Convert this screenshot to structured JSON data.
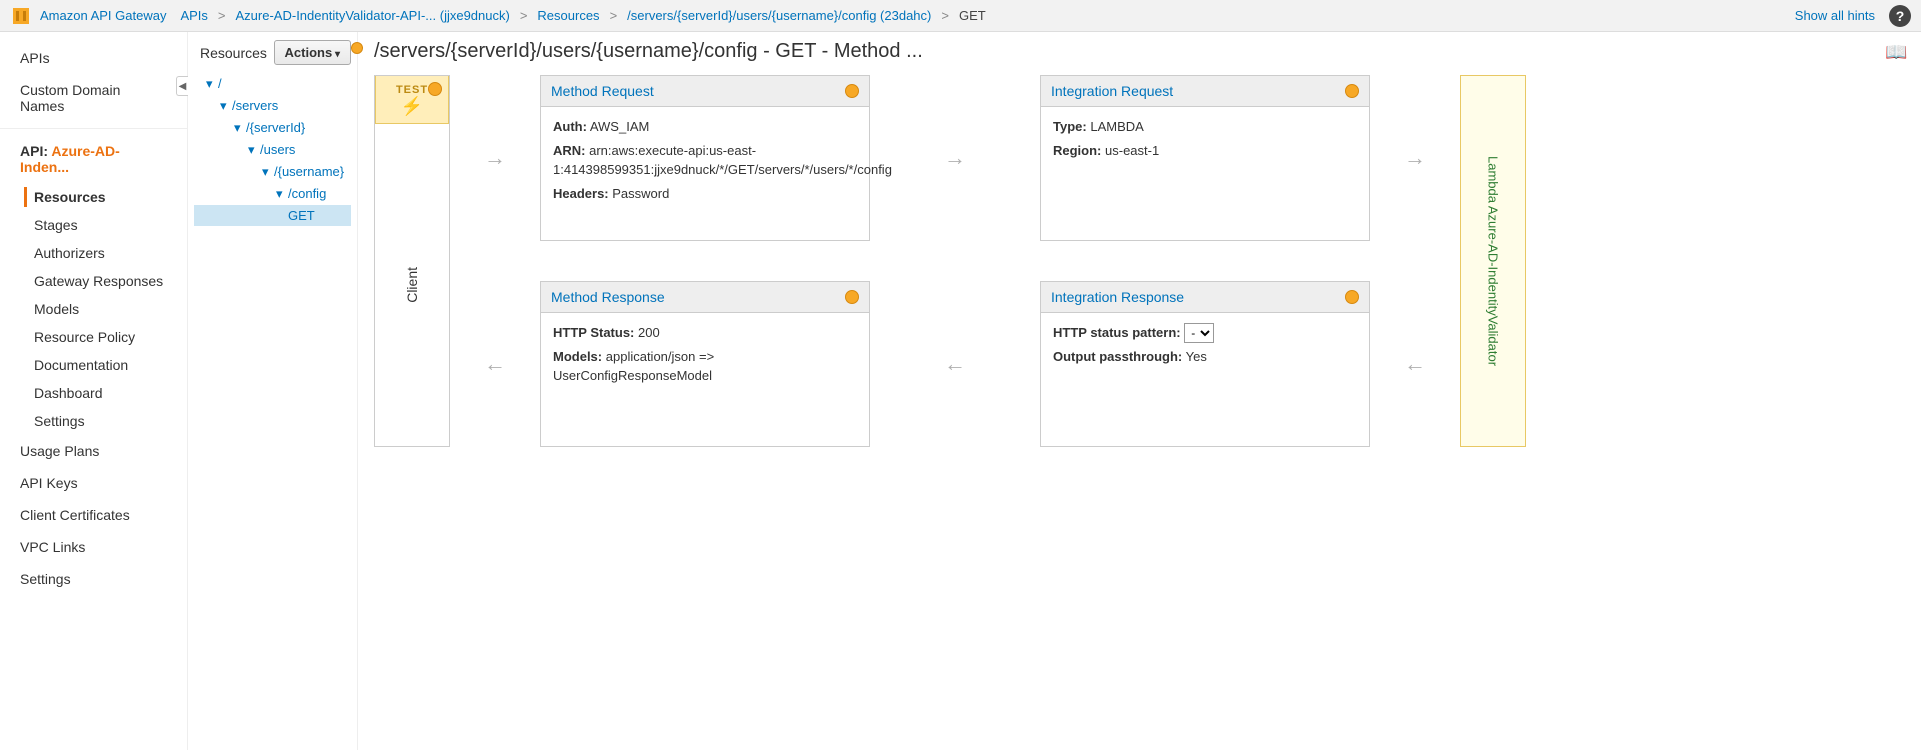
{
  "topbar": {
    "service": "Amazon API Gateway",
    "crumbs": [
      "APIs",
      "Azure-AD-IndentityValidator-API-... (jjxe9dnuck)",
      "Resources",
      "/servers/{serverId}/users/{username}/config (23dahc)",
      "GET"
    ],
    "hints": "Show all hints",
    "help": "?"
  },
  "leftnav": {
    "apis": "APIs",
    "custom_domains": "Custom Domain Names",
    "api_label_prefix": "API:",
    "api_name": "Azure-AD-Inden...",
    "sub": {
      "resources": "Resources",
      "stages": "Stages",
      "authorizers": "Authorizers",
      "gateway_responses": "Gateway Responses",
      "models": "Models",
      "resource_policy": "Resource Policy",
      "documentation": "Documentation",
      "dashboard": "Dashboard",
      "settings_api": "Settings"
    },
    "usage_plans": "Usage Plans",
    "api_keys": "API Keys",
    "client_certs": "Client Certificates",
    "vpc_links": "VPC Links",
    "settings": "Settings"
  },
  "resources": {
    "title": "Resources",
    "actions": "Actions",
    "tree": {
      "root": "/",
      "servers": "/servers",
      "serverId": "/{serverId}",
      "users": "/users",
      "username": "/{username}",
      "config": "/config",
      "get": "GET"
    }
  },
  "main": {
    "title": "/servers/{serverId}/users/{username}/config - GET - Method ...",
    "client_label": "Client",
    "test_label": "TEST",
    "lambda_label": "Lambda Azure-AD-IndentityValidator",
    "method_request": {
      "title": "Method Request",
      "auth_k": "Auth:",
      "auth_v": "AWS_IAM",
      "arn_k": "ARN:",
      "arn_v": "arn:aws:execute-api:us-east-1:414398599351:jjxe9dnuck/*/GET/servers/*/users/*/config",
      "headers_k": "Headers:",
      "headers_v": "Password"
    },
    "integration_request": {
      "title": "Integration Request",
      "type_k": "Type:",
      "type_v": "LAMBDA",
      "region_k": "Region:",
      "region_v": "us-east-1"
    },
    "method_response": {
      "title": "Method Response",
      "status_k": "HTTP Status:",
      "status_v": "200",
      "models_k": "Models:",
      "models_v": "application/json => UserConfigResponseModel"
    },
    "integration_response": {
      "title": "Integration Response",
      "pattern_k": "HTTP status pattern:",
      "pattern_v": "-",
      "passthrough_k": "Output passthrough:",
      "passthrough_v": "Yes"
    }
  }
}
